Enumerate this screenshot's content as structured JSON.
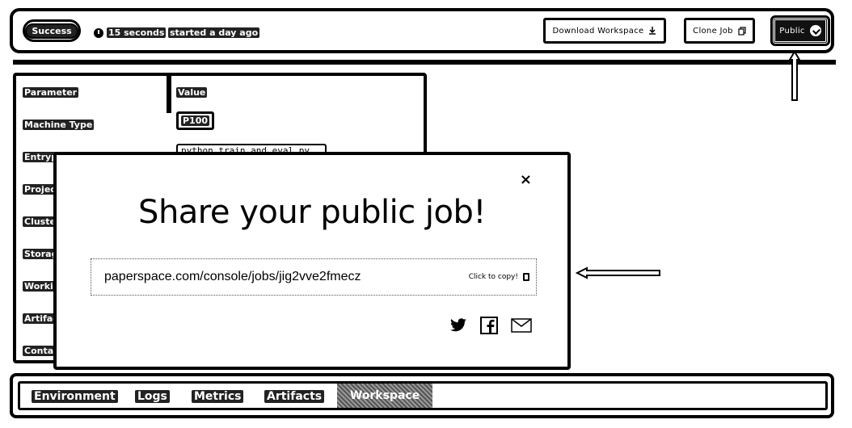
{
  "header": {
    "status": "Success",
    "duration": "15 seconds",
    "started": "started a day ago",
    "buttons": {
      "download": "Download Workspace",
      "clone": "Clone Job",
      "public": "Public"
    }
  },
  "params": {
    "head_parameter": "Parameter",
    "head_value": "Value",
    "rows": [
      "Machine Type",
      "Entrypoint",
      "Project",
      "Cluster",
      "Storage",
      "Workin",
      "Artifac",
      "Contai"
    ],
    "machine_type_value": "P100",
    "entrypoint_value": "python train_and_eval.py"
  },
  "modal": {
    "title": "Share your public job!",
    "url": "paperspace.com/console/jobs/jig2vve2fmecz",
    "copy_hint": "Click to copy!",
    "close": "×"
  },
  "tabs": {
    "items": [
      "Environment",
      "Logs",
      "Metrics",
      "Artifacts"
    ],
    "active": "Workspace"
  },
  "icons": [
    "clock-icon",
    "download-icon",
    "clone-icon",
    "check-badge-icon",
    "close-icon",
    "clipboard-icon",
    "twitter-icon",
    "facebook-icon",
    "mail-icon"
  ]
}
